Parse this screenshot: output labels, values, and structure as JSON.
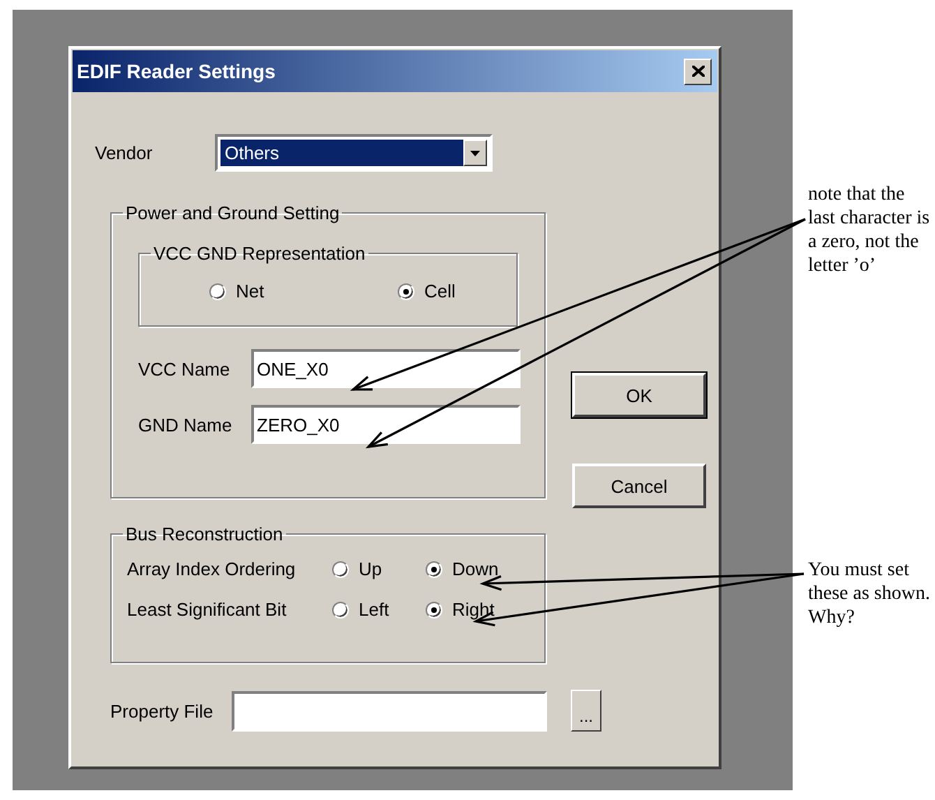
{
  "window": {
    "title": "EDIF Reader Settings"
  },
  "vendor": {
    "label": "Vendor",
    "value": "Others"
  },
  "power_ground": {
    "title": "Power and Ground Setting",
    "representation": {
      "title": "VCC GND Representation",
      "options": [
        {
          "label": "Net",
          "selected": false
        },
        {
          "label": "Cell",
          "selected": true
        }
      ]
    },
    "fields": [
      {
        "label": "VCC Name",
        "value": "ONE_X0"
      },
      {
        "label": "GND Name",
        "value": "ZERO_X0"
      }
    ]
  },
  "bus": {
    "title": "Bus Reconstruction",
    "rows": [
      {
        "label": "Array Index Ordering",
        "options": [
          {
            "label": "Up",
            "selected": false
          },
          {
            "label": "Down",
            "selected": true
          }
        ]
      },
      {
        "label": "Least Significant Bit",
        "options": [
          {
            "label": "Left",
            "selected": false
          },
          {
            "label": "Right",
            "selected": true
          }
        ]
      }
    ]
  },
  "property_file": {
    "label": "Property File",
    "browse": "..."
  },
  "buttons": [
    "OK",
    "Cancel"
  ],
  "annotations": [
    {
      "text": "note that the last character is a zero, not the letter ’o’"
    },
    {
      "text": "You must set these as shown. Why?"
    }
  ]
}
